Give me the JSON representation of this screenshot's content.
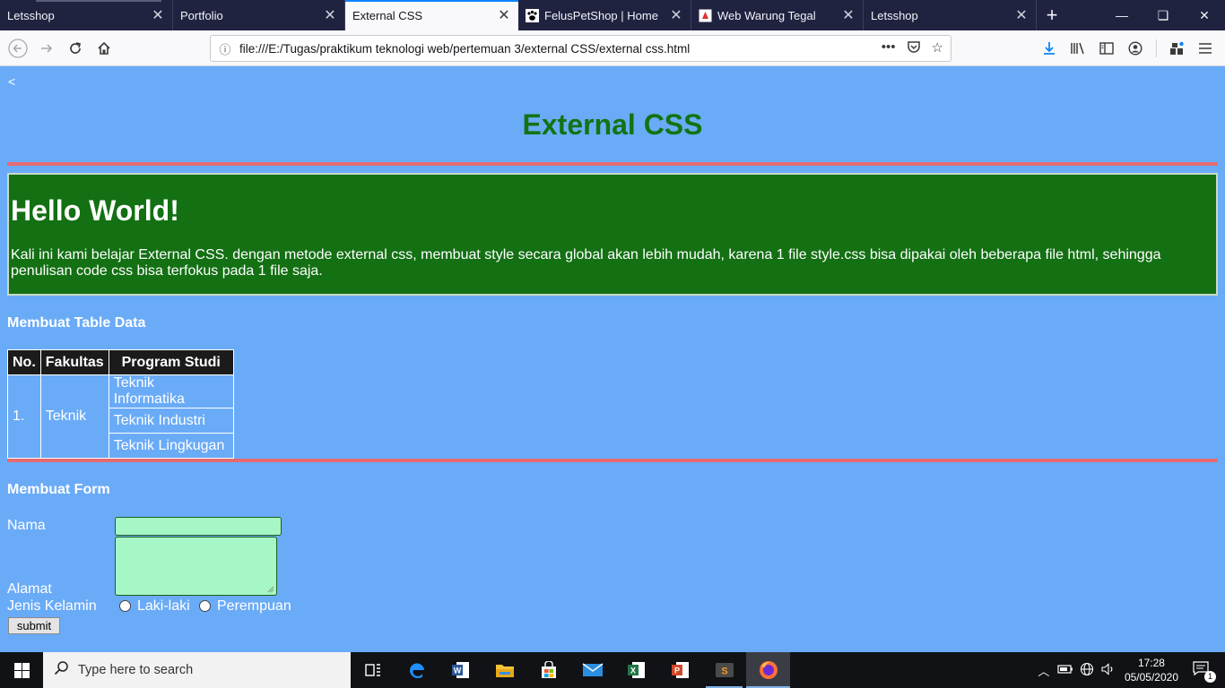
{
  "browser": {
    "tabs": [
      {
        "label": "Letsshop",
        "active": false
      },
      {
        "label": "Portfolio",
        "active": false
      },
      {
        "label": "External CSS",
        "active": true
      },
      {
        "label": "FelusPetShop | Home",
        "active": false
      },
      {
        "label": "Web Warung Tegal",
        "active": false
      },
      {
        "label": "Letsshop",
        "active": false
      }
    ],
    "url": "file:///E:/Tugas/praktikum teknologi web/pertemuan 3/external CSS/external css.html",
    "url_menu": "•••"
  },
  "page": {
    "back_glyph": "<",
    "title": "External CSS",
    "hello_heading": "Hello World!",
    "hello_text": "Kali ini kami belajar External CSS. dengan metode external css, membuat style secara global akan lebih mudah, karena 1 file style.css bisa dipakai oleh beberapa file html, sehingga penulisan code css bisa terfokus pada 1 file saja.",
    "table_heading": "Membuat Table Data",
    "table": {
      "headers": [
        "No.",
        "Fakultas",
        "Program Studi"
      ],
      "no": "1.",
      "fakultas": "Teknik",
      "prodi": [
        "Teknik Informatika",
        "Teknik Industri",
        "Teknik Lingkugan"
      ]
    },
    "form_heading": "Membuat Form",
    "form": {
      "nama_label": "Nama",
      "alamat_label": "Alamat",
      "gender_label": "Jenis Kelamin",
      "option_male": "Laki-laki",
      "option_female": "Perempuan",
      "submit_label": "submit"
    }
  },
  "taskbar": {
    "search_placeholder": "Type here to search",
    "time": "17:28",
    "date": "05/05/2020",
    "notification_count": "1"
  },
  "colors": {
    "page_bg": "#6aabf7",
    "title_green": "#137313",
    "rule_red": "#e66a70",
    "box_green": "#137013",
    "input_green": "#a6f7c5"
  }
}
